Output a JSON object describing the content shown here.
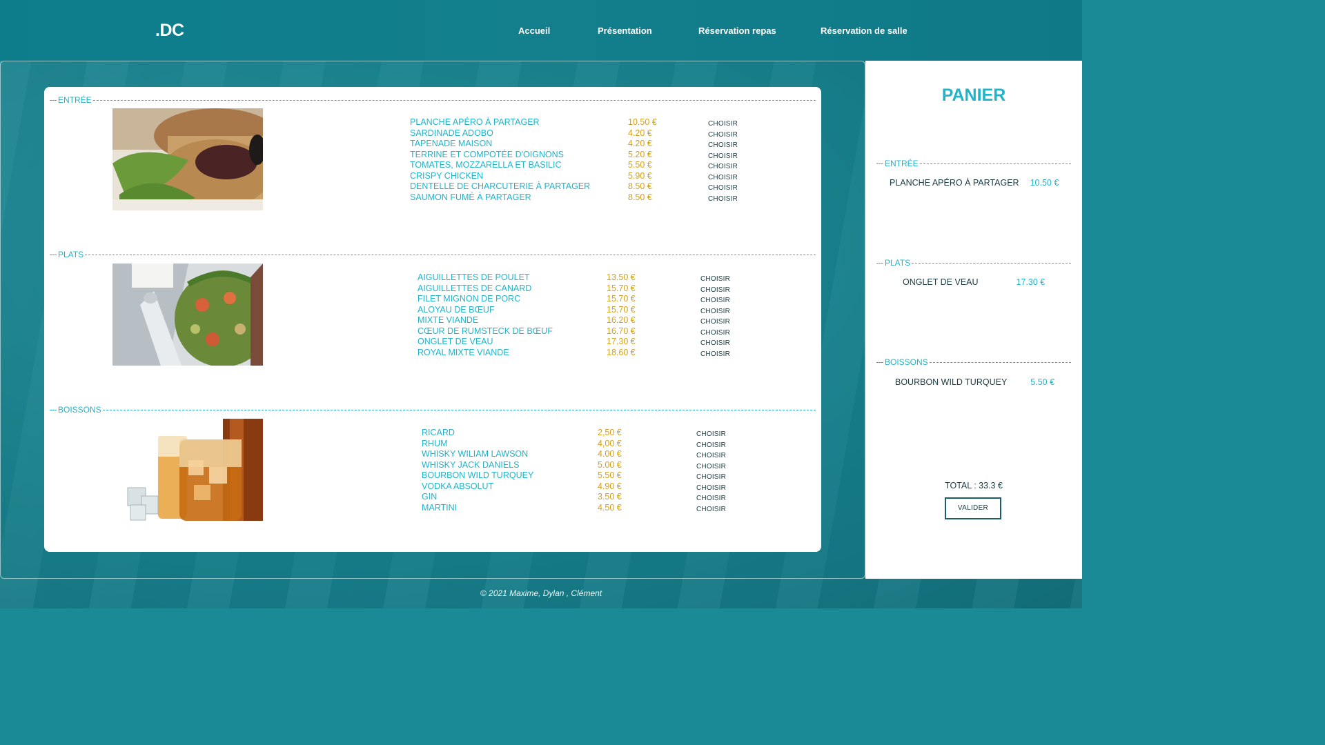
{
  "header": {
    "logo": ".DC",
    "nav": [
      "Accueil",
      "Présentation",
      "Réservation repas",
      "Réservation de salle"
    ]
  },
  "menu": {
    "choose_label": "CHOISIR",
    "sections": [
      {
        "title": "ENTRÉE",
        "items": [
          {
            "name": "PLANCHE APÉRO À PARTAGER",
            "price": "10.50 €"
          },
          {
            "name": "SARDINADE ADOBO",
            "price": "4.20 €"
          },
          {
            "name": "TAPENADE MAISON",
            "price": "4.20 €"
          },
          {
            "name": "TERRINE ET COMPOTÉE D'OIGNONS",
            "price": "5.20 €"
          },
          {
            "name": "TOMATES, MOZZARELLA ET BASILIC",
            "price": "5.50 €"
          },
          {
            "name": "CRISPY CHICKEN",
            "price": "5.90 €"
          },
          {
            "name": "DENTELLE DE CHARCUTERIE À PARTAGER",
            "price": "8.50 €"
          },
          {
            "name": "SAUMON FUMÉ À PARTAGER",
            "price": "8.50 €"
          }
        ]
      },
      {
        "title": "PLATS",
        "items": [
          {
            "name": "AIGUILLETTES DE POULET",
            "price": "13.50 €"
          },
          {
            "name": "AIGUILLETTES DE CANARD",
            "price": "15.70 €"
          },
          {
            "name": "FILET MIGNON DE PORC",
            "price": "15.70 €"
          },
          {
            "name": "ALOYAU DE BŒUF",
            "price": "15.70 €"
          },
          {
            "name": "MIXTE VIANDE",
            "price": "16.20 €"
          },
          {
            "name": "CŒUR DE RUMSTECK DE BŒUF",
            "price": "16.70 €"
          },
          {
            "name": "ONGLET DE VEAU",
            "price": "17.30 €"
          },
          {
            "name": "ROYAL MIXTE VIANDE",
            "price": "18.60 €"
          }
        ]
      },
      {
        "title": "BOISSONS",
        "items": [
          {
            "name": "RICARD",
            "price": "2,50 €"
          },
          {
            "name": "RHUM",
            "price": "4,00 €"
          },
          {
            "name": "WHISKY WILIAM LAWSON",
            "price": "4.00 €"
          },
          {
            "name": "WHISKY JACK DANIELS",
            "price": "5.00 €"
          },
          {
            "name": "BOURBON WILD TURQUEY",
            "price": "5.50 €"
          },
          {
            "name": "VODKA ABSOLUT",
            "price": "4.90 €"
          },
          {
            "name": "GIN",
            "price": "3.50 €"
          },
          {
            "name": "MARTINI",
            "price": "4.50 €"
          }
        ]
      }
    ]
  },
  "cart": {
    "title": "PANIER",
    "sections": [
      {
        "title": "ENTRÉE",
        "item": "PLANCHE APÉRO À PARTAGER",
        "price": "10.50 €"
      },
      {
        "title": "PLATS",
        "item": "ONGLET DE VEAU",
        "price": "17.30 €"
      },
      {
        "title": "BOISSONS",
        "item": "BOURBON WILD TURQUEY",
        "price": "5.50 €"
      }
    ],
    "total": "TOTAL : 33.3 €",
    "validate_label": "VALIDER"
  },
  "footer": "© 2021 Maxime, Dylan , Clément",
  "colors": {
    "accent": "#1fb4c9",
    "price": "#d4a017",
    "header": "#137f8c"
  }
}
